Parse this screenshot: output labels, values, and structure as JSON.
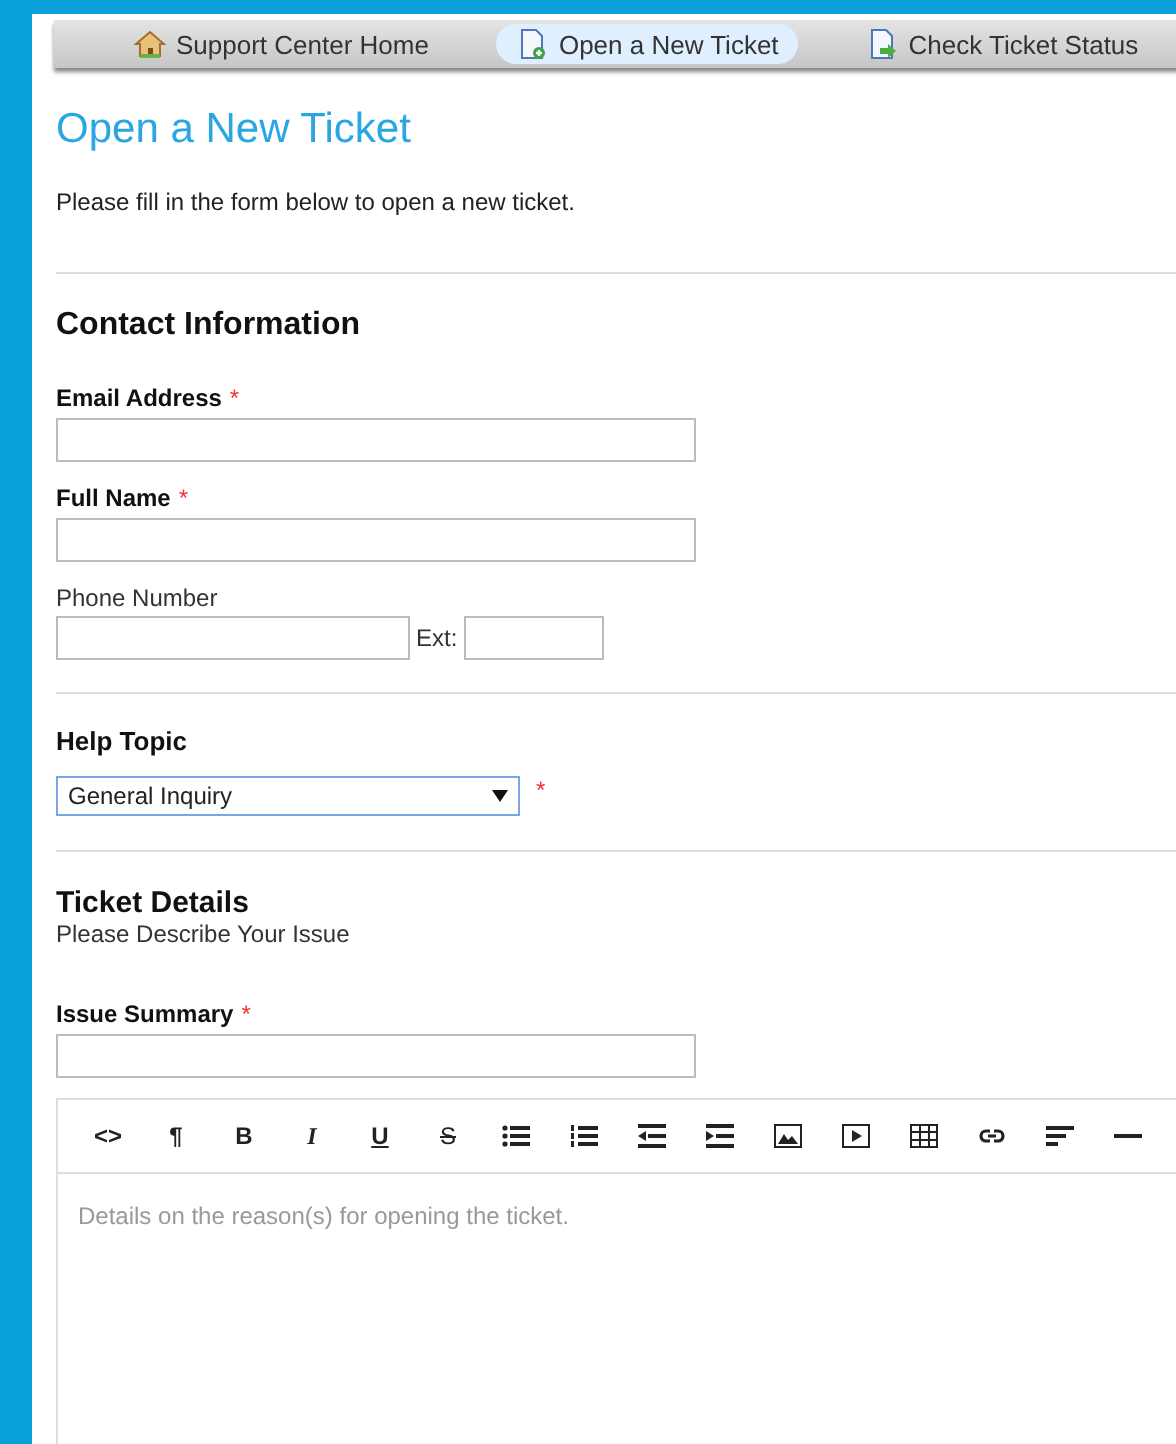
{
  "nav": [
    {
      "label": "Support Center Home",
      "kind": "home",
      "selected": false
    },
    {
      "label": "Open a New Ticket",
      "kind": "new",
      "selected": true
    },
    {
      "label": "Check Ticket Status",
      "kind": "status",
      "selected": false
    }
  ],
  "title": "Open a New Ticket",
  "intro": "Please fill in the form below to open a new ticket.",
  "contact": {
    "heading": "Contact Information",
    "email": {
      "label": "Email Address",
      "required_mark": "*"
    },
    "name": {
      "label": "Full Name",
      "required_mark": "*"
    },
    "phone": {
      "label": "Phone Number",
      "ext_label": "Ext:"
    }
  },
  "help_topic": {
    "label": "Help Topic",
    "value": "General Inquiry",
    "required_mark": "*"
  },
  "details": {
    "heading": "Ticket Details",
    "subheading": "Please Describe Your Issue",
    "summary": {
      "label": "Issue Summary",
      "required_mark": "*"
    },
    "toolbar": [
      {
        "kind": "code",
        "label": "<>"
      },
      {
        "kind": "paragraph",
        "label": "¶"
      },
      {
        "kind": "bold",
        "label": "B"
      },
      {
        "kind": "italic",
        "label": "I"
      },
      {
        "kind": "underline",
        "label": "U"
      },
      {
        "kind": "strike",
        "label": "S"
      },
      {
        "kind": "bullets"
      },
      {
        "kind": "numbers"
      },
      {
        "kind": "outdent"
      },
      {
        "kind": "indent"
      },
      {
        "kind": "image"
      },
      {
        "kind": "video"
      },
      {
        "kind": "table"
      },
      {
        "kind": "link"
      },
      {
        "kind": "align"
      },
      {
        "kind": "rule"
      }
    ],
    "editor_placeholder": "Details on the reason(s) for opening the ticket."
  }
}
